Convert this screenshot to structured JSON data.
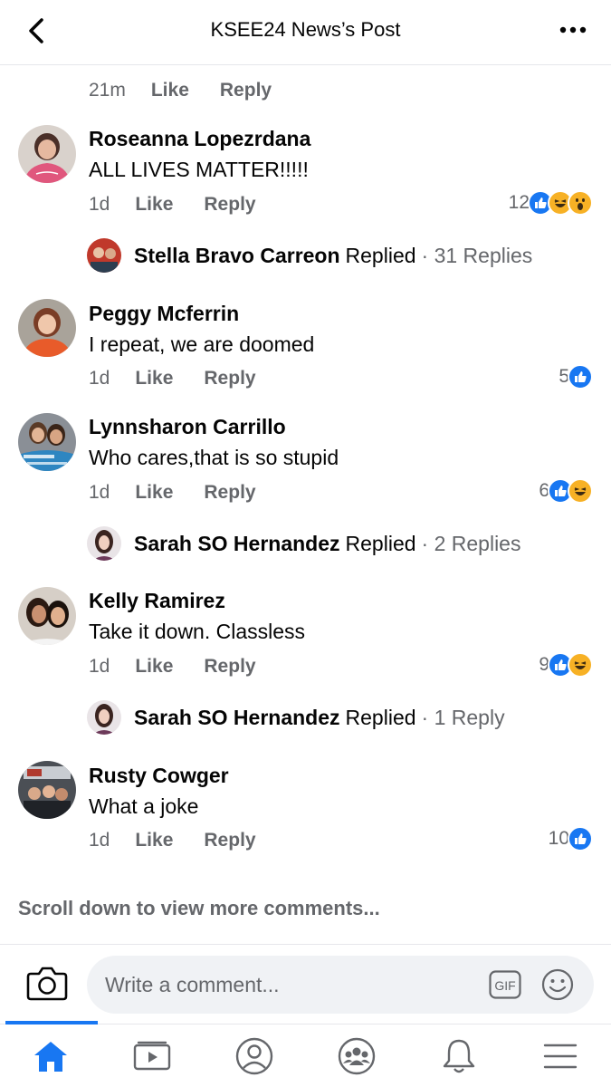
{
  "header": {
    "title": "KSEE24 News’s Post",
    "back_icon": "chevron-left-icon",
    "more_icon": "more-horizontal-icon"
  },
  "top_meta": {
    "time": "21m",
    "like": "Like",
    "reply": "Reply"
  },
  "comments": [
    {
      "author": "Roseanna Lopezrdana",
      "text": "ALL LIVES MATTER!!!!!",
      "time": "1d",
      "like": "Like",
      "reply": "Reply",
      "reaction_count": "12",
      "reactions": [
        "like",
        "haha",
        "wow"
      ],
      "replied": {
        "name": "Stella Bravo Carreon",
        "word": "Replied",
        "count": "· 31 Replies"
      }
    },
    {
      "author": "Peggy Mcferrin",
      "text": "I repeat, we are doomed",
      "time": "1d",
      "like": "Like",
      "reply": "Reply",
      "reaction_count": "5",
      "reactions": [
        "like"
      ]
    },
    {
      "author": "Lynnsharon Carrillo",
      "text": "Who cares,that is so stupid",
      "time": "1d",
      "like": "Like",
      "reply": "Reply",
      "reaction_count": "6",
      "reactions": [
        "like",
        "haha"
      ],
      "replied": {
        "name": "Sarah SO Hernandez",
        "word": "Replied",
        "count": "· 2 Replies"
      }
    },
    {
      "author": "Kelly Ramirez",
      "text": "Take it down. Classless",
      "time": "1d",
      "like": "Like",
      "reply": "Reply",
      "reaction_count": "9",
      "reactions": [
        "like",
        "haha"
      ],
      "replied": {
        "name": "Sarah SO Hernandez",
        "word": "Replied",
        "count": "· 1 Reply"
      }
    },
    {
      "author": "Rusty Cowger",
      "text": "What a joke",
      "time": "1d",
      "like": "Like",
      "reply": "Reply",
      "reaction_count": "10",
      "reactions": [
        "like"
      ]
    }
  ],
  "scroll_more": "Scroll down to view more comments...",
  "composer": {
    "placeholder": "Write a comment...",
    "camera_icon": "camera-icon",
    "gif_label": "GIF",
    "emoji_icon": "emoji-icon"
  },
  "tabbar": {
    "items": [
      "home",
      "watch",
      "profile",
      "groups",
      "notifications",
      "menu"
    ],
    "active": "home",
    "accent": "#1877f2"
  },
  "colors": {
    "like_blue": "#1877f2",
    "haha_yellow": "#f7b125",
    "secondary_text": "#65676b"
  }
}
